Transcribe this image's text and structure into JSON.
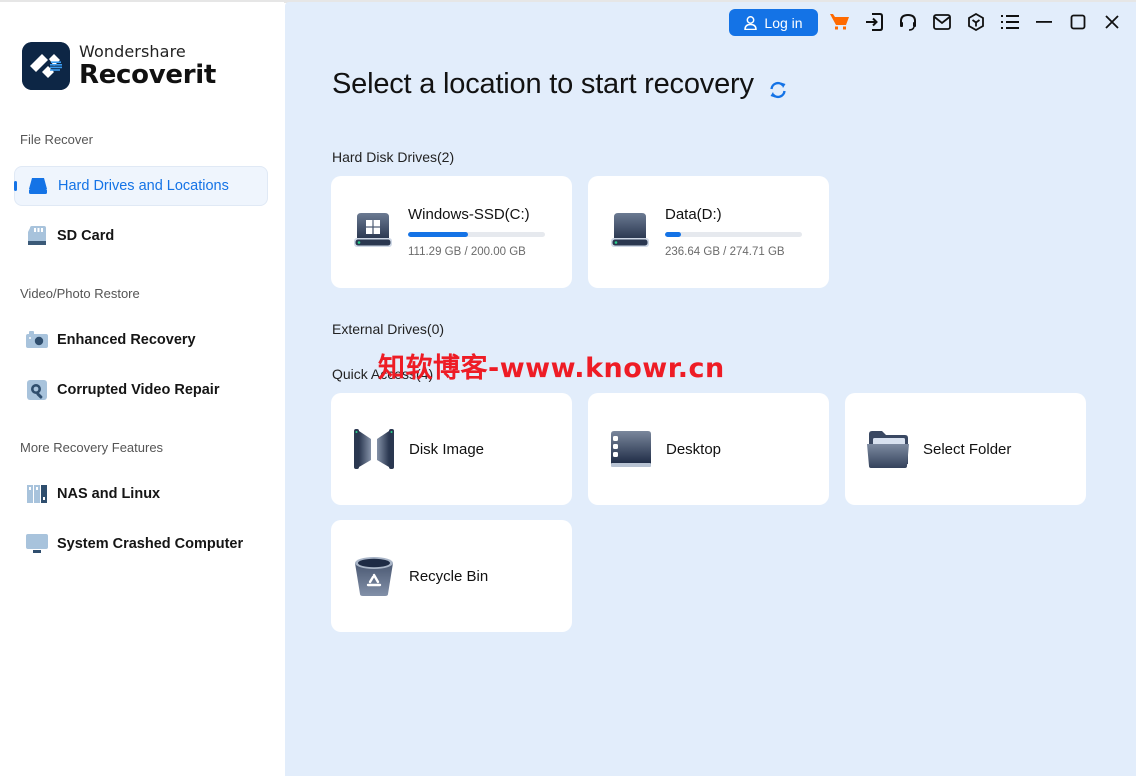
{
  "app": {
    "brand": "Wondershare",
    "product": "Recoverit"
  },
  "sidebar": {
    "sections": [
      {
        "label": "File Recover",
        "items": [
          {
            "label": "Hard Drives and Locations",
            "icon": "hard-drive-icon",
            "active": true
          },
          {
            "label": "SD Card",
            "icon": "sd-card-icon",
            "active": false
          }
        ]
      },
      {
        "label": "Video/Photo Restore",
        "items": [
          {
            "label": "Enhanced Recovery",
            "icon": "camera-icon",
            "active": false
          },
          {
            "label": "Corrupted Video Repair",
            "icon": "video-repair-icon",
            "active": false
          }
        ]
      },
      {
        "label": "More Recovery Features",
        "items": [
          {
            "label": "NAS and Linux",
            "icon": "nas-icon",
            "active": false
          },
          {
            "label": "System Crashed Computer",
            "icon": "monitor-icon",
            "active": false
          }
        ]
      }
    ]
  },
  "header": {
    "login_label": "Log in",
    "icons": [
      "cart-icon",
      "sign-in-icon",
      "headset-icon",
      "mail-icon",
      "cube-icon",
      "menu-icon",
      "minimize-icon",
      "maximize-icon",
      "close-icon"
    ],
    "accent": "#1473e6",
    "cart_color": "#ff6a00"
  },
  "main": {
    "title": "Select a location to start recovery",
    "hard_disk_label": "Hard Disk Drives(2)",
    "drives": [
      {
        "name": "Windows-SSD(C:)",
        "used": "111.29 GB",
        "total": "200.00 GB",
        "size_text": "111.29 GB / 200.00 GB",
        "fill_pct": 44
      },
      {
        "name": "Data(D:)",
        "used": "236.64 GB",
        "total": "274.71 GB",
        "size_text": "236.64 GB / 274.71 GB",
        "fill_pct": 12
      }
    ],
    "external_label": "External Drives(0)",
    "quick_access_label": "Quick Access(4)",
    "quick_access": [
      {
        "label": "Disk Image",
        "icon": "disk-image-icon"
      },
      {
        "label": "Desktop",
        "icon": "desktop-icon"
      },
      {
        "label": "Select Folder",
        "icon": "folder-icon"
      },
      {
        "label": "Recycle Bin",
        "icon": "recycle-bin-icon"
      }
    ]
  },
  "watermark": "知软博客-www.knowr.cn"
}
